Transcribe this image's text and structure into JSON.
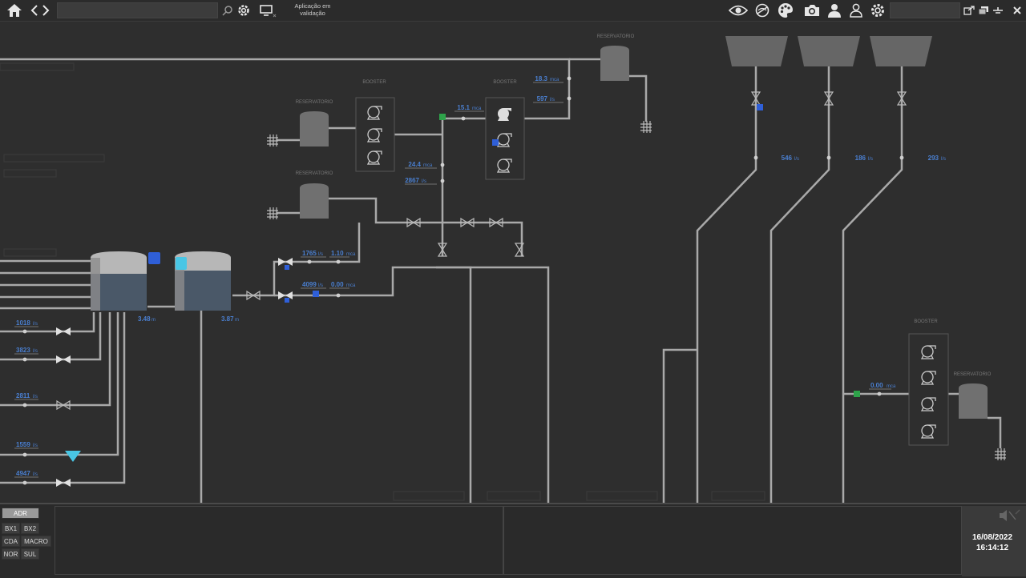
{
  "toolbar": {
    "search_value": "",
    "app_status": "Aplicação em validação",
    "right_search_value": ""
  },
  "labels": {
    "reservatorio": "RESERVATORIO",
    "booster": "BOOSTER"
  },
  "readings": {
    "r1": {
      "value": "18.3",
      "unit": "mca"
    },
    "r2": {
      "value": "597",
      "unit": "l/s"
    },
    "r3": {
      "value": "15.1",
      "unit": "mca"
    },
    "r4": {
      "value": "24.4",
      "unit": "mca"
    },
    "r5": {
      "value": "2867",
      "unit": "l/s"
    },
    "r6": {
      "value": "1765",
      "unit": "l/s"
    },
    "r7": {
      "value": "1.10",
      "unit": "mca"
    },
    "r8": {
      "value": "4099",
      "unit": "l/s"
    },
    "r9": {
      "value": "0.00",
      "unit": "mca"
    },
    "r10": {
      "value": "546",
      "unit": "l/s"
    },
    "r11": {
      "value": "186",
      "unit": "l/s"
    },
    "r12": {
      "value": "293",
      "unit": "l/s"
    },
    "r13": {
      "value": "0.00",
      "unit": "mca"
    },
    "l1": {
      "value": "1018",
      "unit": "l/s"
    },
    "l2": {
      "value": "3823",
      "unit": "l/s"
    },
    "l3": {
      "value": "2811",
      "unit": "l/s"
    },
    "l4": {
      "value": "1559",
      "unit": "l/s"
    },
    "l5": {
      "value": "4947",
      "unit": "l/s"
    },
    "tank1_level": "3.48",
    "tank2_level": "3.87",
    "level_unit": "m"
  },
  "bottom": {
    "buttons": {
      "adr": "ADR",
      "bx1": "BX1",
      "bx2": "BX2",
      "cda": "CDA",
      "macro": "MACRO",
      "nor": "NOR",
      "sul": "SUL"
    },
    "date": "16/08/2022",
    "time": "16:14:12"
  },
  "colors": {
    "accent": "#4a7fd0",
    "pipe": "#a9a9a9",
    "green": "#2ea34a",
    "cyan": "#49c6e5"
  },
  "icons": [
    "home-icon",
    "back-icon",
    "forward-icon",
    "search-icon",
    "settings-icon",
    "monitor-icon",
    "eye-icon",
    "eye-off-icon",
    "palette-icon",
    "camera-icon",
    "user-icon",
    "user-outline-icon",
    "gear-icon",
    "export-icon",
    "windows-icon",
    "minimize-icon",
    "close-icon",
    "mute-icon"
  ]
}
